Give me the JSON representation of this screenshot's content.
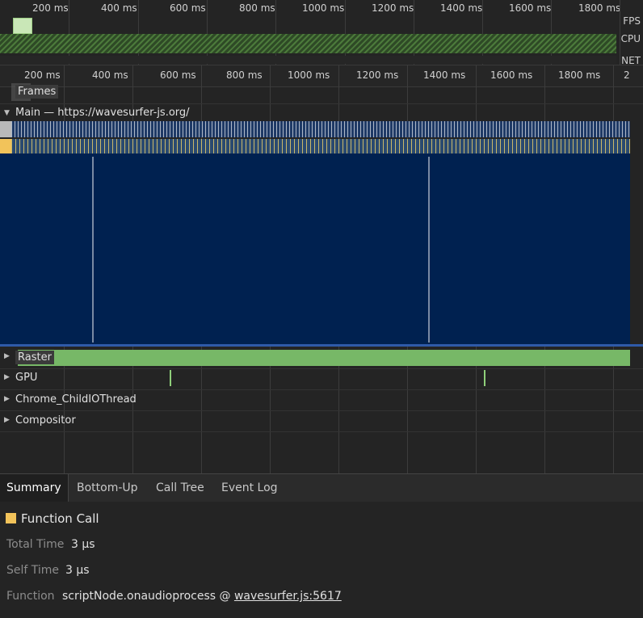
{
  "overview": {
    "ticks": [
      "200 ms",
      "400 ms",
      "600 ms",
      "800 ms",
      "1000 ms",
      "1200 ms",
      "1400 ms",
      "1600 ms",
      "1800 ms"
    ],
    "lanes": {
      "fps": "FPS",
      "cpu": "CPU",
      "net": "NET"
    }
  },
  "main_ruler": {
    "ticks": [
      "200 ms",
      "400 ms",
      "600 ms",
      "800 ms",
      "1000 ms",
      "1200 ms",
      "1400 ms",
      "1600 ms",
      "1800 ms",
      "2"
    ]
  },
  "tracks": {
    "frames": "Frames",
    "main": "Main — https://wavesurfer-js.org/",
    "raster": "Raster",
    "gpu": "GPU",
    "childio": "Chrome_ChildIOThread",
    "compositor": "Compositor"
  },
  "tabs": [
    "Summary",
    "Bottom-Up",
    "Call Tree",
    "Event Log"
  ],
  "summary": {
    "title": "Function Call",
    "total_time_label": "Total Time",
    "total_time_value": "3 µs",
    "self_time_label": "Self Time",
    "self_time_value": "3 µs",
    "function_label": "Function",
    "function_name": "scriptNode.onaudioprocess @ ",
    "function_link": "wavesurfer.js:5617"
  },
  "colors": {
    "function_call": "#f2c35a",
    "raster": "#77b867",
    "flame_bg": "#002150"
  }
}
